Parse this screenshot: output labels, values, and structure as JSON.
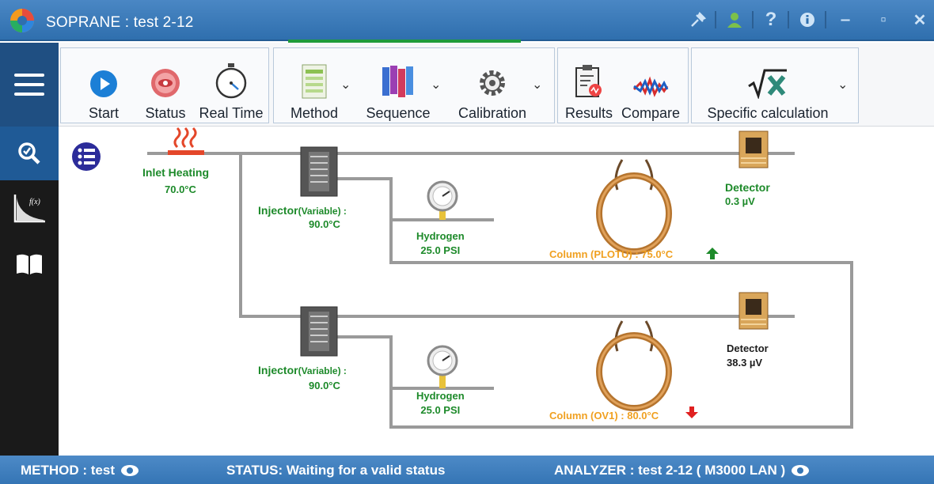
{
  "window": {
    "title": "SOPRANE : test 2-12",
    "icons": [
      "pin-icon",
      "user-icon",
      "help-icon",
      "info-icon",
      "minimize-icon",
      "maximize-icon",
      "close-icon"
    ],
    "help_glyph": "?",
    "minimize_glyph": "‒",
    "maximize_glyph": "▫",
    "close_glyph": "✕"
  },
  "ribbon": {
    "run_group": [
      {
        "label": "Start",
        "icon": "play-icon"
      },
      {
        "label": "Status",
        "icon": "status-eye-icon"
      },
      {
        "label": "Real Time",
        "icon": "stopwatch-icon"
      }
    ],
    "method_group": [
      {
        "label": "Method",
        "icon": "method-sheet-icon",
        "dropdown": true
      },
      {
        "label": "Sequence",
        "icon": "sequence-icon",
        "dropdown": true
      },
      {
        "label": "Calibration",
        "icon": "calibration-gear-icon",
        "dropdown": true
      }
    ],
    "results_group": [
      {
        "label": "Results",
        "icon": "results-clipboard-icon"
      },
      {
        "label": "Compare",
        "icon": "compare-signal-icon"
      }
    ],
    "calc_group": [
      {
        "label": "Specific calculation",
        "icon": "sqrt-x-icon",
        "dropdown": true
      }
    ],
    "chevron_glyph": "⌄"
  },
  "sidebar": {
    "items": [
      {
        "icon": "analysis-search-icon",
        "active": true
      },
      {
        "icon": "function-chart-icon",
        "active": false
      },
      {
        "icon": "book-icon",
        "active": false
      }
    ],
    "chart_label": "f(x)"
  },
  "diagram": {
    "inlet": {
      "label": "Inlet Heating",
      "value": "70.0°C"
    },
    "channel1": {
      "injector_label": "Injector",
      "injector_mode": "(Variable) :",
      "injector_value": "90.0°C",
      "gas_label": "Hydrogen",
      "gas_value": "25.0 PSI",
      "column_label": "Column (PLOTU) : 75.0°C",
      "column_trend": "up",
      "detector_label": "Detector",
      "detector_value": "0.3 µV"
    },
    "channel2": {
      "injector_label": "Injector",
      "injector_mode": "(Variable) :",
      "injector_value": "90.0°C",
      "gas_label": "Hydrogen",
      "gas_value": "25.0 PSI",
      "column_label": "Column (OV1) : 80.0°C",
      "column_trend": "down",
      "detector_label": "Detector",
      "detector_value": "38.3 µV"
    }
  },
  "statusbar": {
    "method": "METHOD  :  test",
    "status": "STATUS:  Waiting for a valid status",
    "analyzer": "ANALYZER :  test 2-12 ( M3000 LAN )"
  },
  "colors": {
    "titlebar": "#3a7bbd",
    "progress": "#1f9b3a",
    "sidebar": "#1a1a1a",
    "sidebar_active": "#1f5a96",
    "ok_green": "#1d8a2a",
    "column_orange": "#f0a020",
    "trend_up": "#1d8a2a",
    "trend_down": "#e02020"
  }
}
